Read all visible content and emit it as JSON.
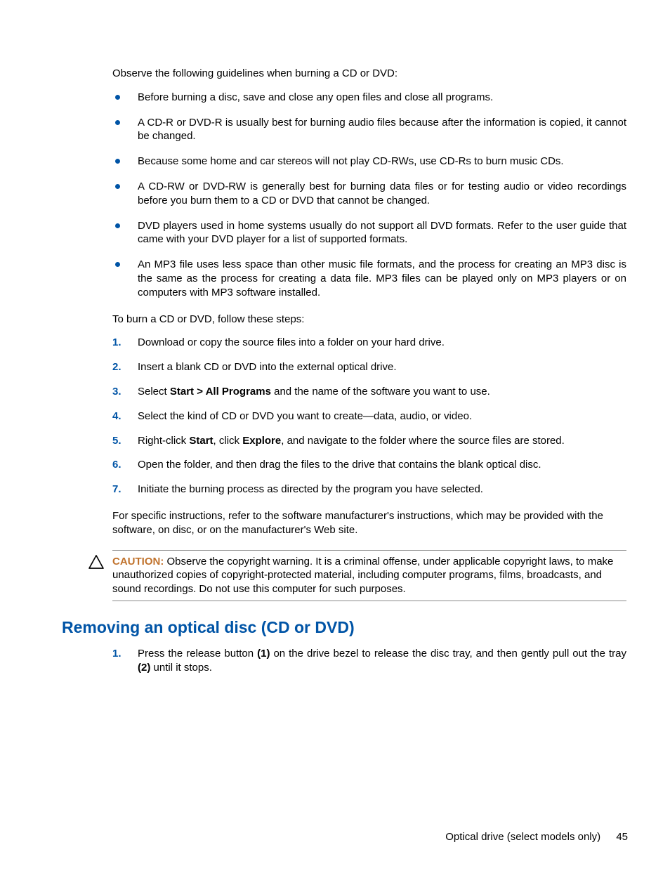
{
  "intro": "Observe the following guidelines when burning a CD or DVD:",
  "bullets": [
    "Before burning a disc, save and close any open files and close all programs.",
    "A CD-R or DVD-R is usually best for burning audio files because after the information is copied, it cannot be changed.",
    "Because some home and car stereos will not play CD-RWs, use CD-Rs to burn music CDs.",
    "A CD-RW or DVD-RW is generally best for burning data files or for testing audio or video recordings before you burn them to a CD or DVD that cannot be changed.",
    "DVD players used in home systems usually do not support all DVD formats. Refer to the user guide that came with your DVD player for a list of supported formats.",
    "An MP3 file uses less space than other music file formats, and the process for creating an MP3 disc is the same as the process for creating a data file. MP3 files can be played only on MP3 players or on computers with MP3 software installed."
  ],
  "steps_intro": "To burn a CD or DVD, follow these steps:",
  "steps": {
    "s1": "Download or copy the source files into a folder on your hard drive.",
    "s2": "Insert a blank CD or DVD into the external optical drive.",
    "s3": {
      "pre": "Select ",
      "bold": "Start > All Programs",
      "post": " and the name of the software you want to use."
    },
    "s4": "Select the kind of CD or DVD you want to create—data, audio, or video.",
    "s5": {
      "a": "Right-click ",
      "b": "Start",
      "c": ", click ",
      "d": "Explore",
      "e": ", and navigate to the folder where the source files are stored."
    },
    "s6": "Open the folder, and then drag the files to the drive that contains the blank optical disc.",
    "s7": "Initiate the burning process as directed by the program you have selected."
  },
  "post_steps": "For specific instructions, refer to the software manufacturer's instructions, which may be provided with the software, on disc, or on the manufacturer's Web site.",
  "caution": {
    "label": "CAUTION:",
    "text": "Observe the copyright warning. It is a criminal offense, under applicable copyright laws, to make unauthorized copies of copyright-protected material, including computer programs, films, broadcasts, and sound recordings. Do not use this computer for such purposes."
  },
  "heading": "Removing an optical disc (CD or DVD)",
  "removal_step": {
    "a": "Press the release button ",
    "b": "(1)",
    "c": " on the drive bezel to release the disc tray, and then gently pull out the tray ",
    "d": "(2)",
    "e": " until it stops."
  },
  "footer": {
    "section": "Optical drive (select models only)",
    "page": "45"
  }
}
